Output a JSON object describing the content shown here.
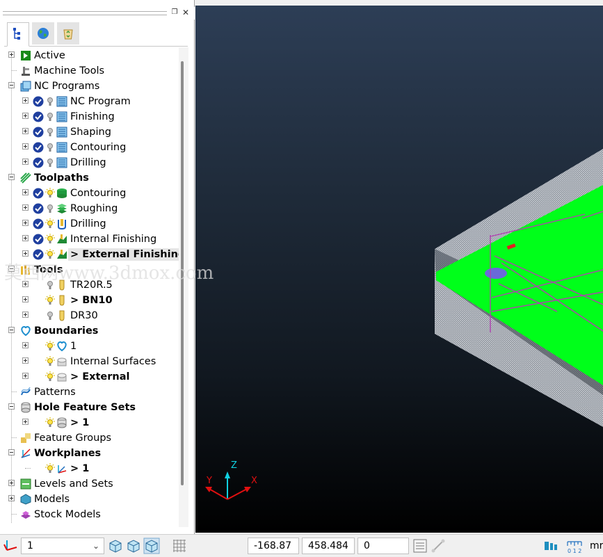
{
  "panel": {
    "pin_glyph": "❐",
    "close_glyph": "✕",
    "tabs": [
      {
        "name": "explorer-tree-icon",
        "active": true
      },
      {
        "name": "globe-icon",
        "active": false
      },
      {
        "name": "recycle-bin-icon",
        "active": false
      }
    ]
  },
  "tree": [
    {
      "label": "Active",
      "bold": false,
      "depth": 0,
      "expander": "closed",
      "icons": [
        "active-icon"
      ]
    },
    {
      "label": "Machine Tools",
      "bold": false,
      "depth": 0,
      "expander": "none",
      "icons": [
        "machine-tool-icon"
      ]
    },
    {
      "label": "NC Programs",
      "bold": false,
      "depth": 0,
      "expander": "open",
      "icons": [
        "nc-programs-icon"
      ]
    },
    {
      "label": "NC Program",
      "bold": false,
      "depth": 1,
      "expander": "closed",
      "icons": [
        "check-icon",
        "bulb-off-icon",
        "nc-program-icon"
      ]
    },
    {
      "label": "Finishing",
      "bold": false,
      "depth": 1,
      "expander": "closed",
      "icons": [
        "check-icon",
        "bulb-off-icon",
        "nc-program-icon"
      ]
    },
    {
      "label": "Shaping",
      "bold": false,
      "depth": 1,
      "expander": "closed",
      "icons": [
        "check-icon",
        "bulb-off-icon",
        "nc-program-icon"
      ]
    },
    {
      "label": "Contouring",
      "bold": false,
      "depth": 1,
      "expander": "closed",
      "icons": [
        "check-icon",
        "bulb-off-icon",
        "nc-program-icon"
      ]
    },
    {
      "label": "Drilling",
      "bold": false,
      "depth": 1,
      "expander": "closed",
      "icons": [
        "check-icon",
        "bulb-off-icon",
        "nc-program-icon"
      ]
    },
    {
      "label": "Toolpaths",
      "bold": true,
      "depth": 0,
      "expander": "open",
      "icons": [
        "toolpaths-icon"
      ]
    },
    {
      "label": "Contouring",
      "bold": false,
      "depth": 1,
      "expander": "closed",
      "icons": [
        "check-icon",
        "bulb-on-icon",
        "contouring-toolpath-icon"
      ]
    },
    {
      "label": "Roughing",
      "bold": false,
      "depth": 1,
      "expander": "closed",
      "icons": [
        "check-icon",
        "bulb-off-icon",
        "roughing-toolpath-icon"
      ]
    },
    {
      "label": "Drilling",
      "bold": false,
      "depth": 1,
      "expander": "closed",
      "icons": [
        "check-icon",
        "bulb-on-icon",
        "drilling-toolpath-icon"
      ]
    },
    {
      "label": "Internal Finishing",
      "bold": false,
      "depth": 1,
      "expander": "closed",
      "icons": [
        "check-icon",
        "bulb-on-icon",
        "finishing-toolpath-icon"
      ]
    },
    {
      "label": "> External Finishing",
      "bold": true,
      "depth": 1,
      "expander": "closed",
      "icons": [
        "check-icon",
        "bulb-on-icon",
        "finishing-toolpath-icon"
      ],
      "highlight": true
    },
    {
      "label": "Tools",
      "bold": true,
      "depth": 0,
      "expander": "open",
      "icons": [
        "tools-icon"
      ]
    },
    {
      "label": "TR20R.5",
      "bold": false,
      "depth": 1,
      "expander": "closed",
      "icons": [
        "blank",
        "bulb-off-icon",
        "tool-icon"
      ]
    },
    {
      "label": "> BN10",
      "bold": true,
      "depth": 1,
      "expander": "closed",
      "icons": [
        "blank",
        "bulb-on-icon",
        "tool-icon"
      ]
    },
    {
      "label": "DR30",
      "bold": false,
      "depth": 1,
      "expander": "closed",
      "icons": [
        "blank",
        "bulb-off-icon",
        "tool-icon"
      ]
    },
    {
      "label": "Boundaries",
      "bold": true,
      "depth": 0,
      "expander": "open",
      "icons": [
        "boundaries-icon"
      ]
    },
    {
      "label": "1",
      "bold": false,
      "depth": 1,
      "expander": "closed",
      "icons": [
        "blank",
        "bulb-on-icon",
        "boundary-icon"
      ]
    },
    {
      "label": "Internal Surfaces",
      "bold": false,
      "depth": 1,
      "expander": "closed",
      "icons": [
        "blank",
        "bulb-on-icon",
        "boundary-grey-icon"
      ]
    },
    {
      "label": "> External",
      "bold": true,
      "depth": 1,
      "expander": "closed",
      "icons": [
        "blank",
        "bulb-on-icon",
        "boundary-grey-icon"
      ]
    },
    {
      "label": "Patterns",
      "bold": false,
      "depth": 0,
      "expander": "none",
      "icons": [
        "patterns-icon"
      ]
    },
    {
      "label": "Hole Feature Sets",
      "bold": true,
      "depth": 0,
      "expander": "open",
      "icons": [
        "hole-feature-sets-icon"
      ]
    },
    {
      "label": "> 1",
      "bold": true,
      "depth": 1,
      "expander": "closed",
      "icons": [
        "blank",
        "bulb-on-icon",
        "hole-feature-icon"
      ]
    },
    {
      "label": "Feature Groups",
      "bold": false,
      "depth": 0,
      "expander": "none",
      "icons": [
        "feature-groups-icon"
      ]
    },
    {
      "label": "Workplanes",
      "bold": true,
      "depth": 0,
      "expander": "open",
      "icons": [
        "workplanes-icon"
      ]
    },
    {
      "label": "> 1",
      "bold": true,
      "depth": 1,
      "expander": "none",
      "icons": [
        "blank",
        "bulb-on-icon",
        "workplane-icon"
      ]
    },
    {
      "label": "Levels and Sets",
      "bold": false,
      "depth": 0,
      "expander": "closed",
      "icons": [
        "levels-icon"
      ]
    },
    {
      "label": "Models",
      "bold": false,
      "depth": 0,
      "expander": "closed",
      "icons": [
        "models-icon"
      ]
    },
    {
      "label": "Stock Models",
      "bold": false,
      "depth": 0,
      "expander": "none",
      "icons": [
        "stock-models-icon"
      ]
    }
  ],
  "viewport": {
    "watermark": "莫西网www.3dmox.com",
    "axis": {
      "x": "X",
      "y": "Y",
      "z": "Z"
    }
  },
  "status": {
    "workplane_value": "1",
    "coord_x": "-168.87",
    "coord_y": "458.484",
    "coord_z": "0",
    "units_partial": "mr"
  },
  "colors": {
    "model_green": "#00ff1a",
    "toolpath_magenta": "#c040c0",
    "selection_blue": "#1f6fd6"
  }
}
